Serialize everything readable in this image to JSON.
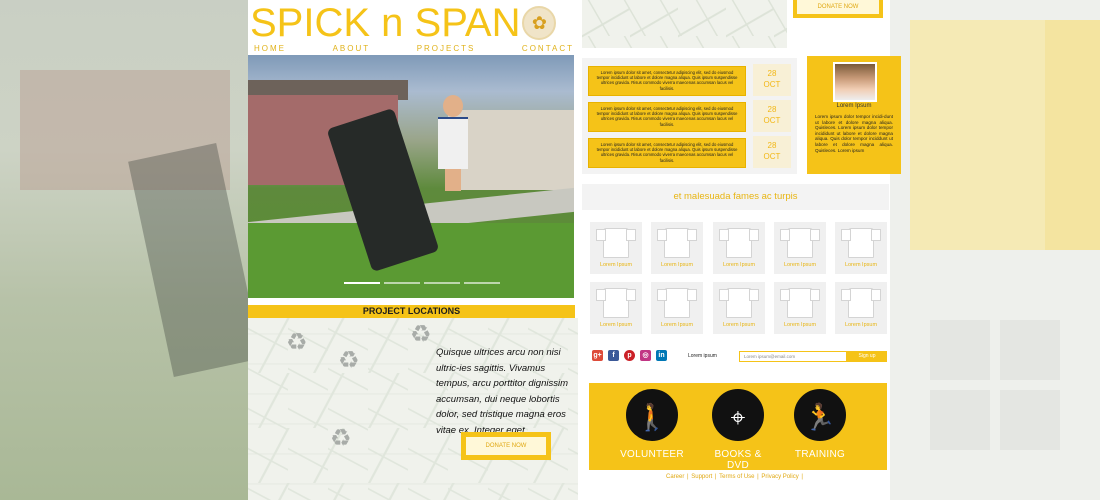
{
  "site": {
    "logo_text": "SPICK n SPAN",
    "nav": [
      "HOME",
      "ABOUT",
      "PROJECTS",
      "CONTACT"
    ]
  },
  "hero": {
    "slide_count": 4,
    "active_slide": 1
  },
  "project_locations": {
    "heading": "PROJECT LOCATIONS",
    "quote": "Quisque ultrices arcu non nisi ultric-ies sagittis. Vivamus tempus, arcu porttitor dignissim accumsan, dui neque lobortis dolor, sed tristique magna eros vitae ex. Integer eget",
    "donate_label": "DONATE NOW"
  },
  "top_donate_label": "DONATE NOW",
  "events": [
    {
      "text": "Lorem ipsum dolor sit amet, consectetur adipiscing elit, sed do eiusmod tempor incididunt ut labore et dolore magna aliqua. Quis ipsum suspendisse ultrices gravida. Risus commodo viverra maecenas accumsan lacus vel facilisis.",
      "day": "28",
      "month": "OCT"
    },
    {
      "text": "Lorem ipsum dolor sit amet, consectetur adipiscing elit, sed do eiusmod tempor incididunt ut labore et dolore magna aliqua. Quis ipsum suspendisse ultrices gravida. Risus commodo viverra maecenas accumsan lacus vel facilisis.",
      "day": "28",
      "month": "OCT"
    },
    {
      "text": "Lorem ipsum dolor sit amet, consectetur adipiscing elit, sed do eiusmod tempor incididunt ut labore et dolore magna aliqua. Quis ipsum suspendisse ultrices gravida. Risus commodo viverra maecenas accumsan lacus vel facilisis.",
      "day": "28",
      "month": "OCT"
    }
  ],
  "profile": {
    "name": "Lorem Ipsum",
    "bio": "Lorem ipsum dolor tempor incidi-dunt ut labore et dolore magna aliqua. Quisleces. Lorem ipsum dolor tempor incididunt ut labore et dolore magna aliqua. Quis dolor tempor inciddunt ut labore et dolore magna aliqua. Quisleces. Lorem ipsum"
  },
  "merch": {
    "heading": "et malesuada fames ac turpis",
    "items": [
      "Lorem Ipsum",
      "Lorem Ipsum",
      "Lorem Ipsum",
      "Lorem Ipsum",
      "Lorem Ipsum",
      "Lorem Ipsum",
      "Lorem Ipsum",
      "Lorem Ipsum",
      "Lorem Ipsum",
      "Lorem Ipsum"
    ]
  },
  "social": {
    "icons": [
      "google-plus-icon",
      "facebook-icon",
      "pinterest-icon",
      "instagram-icon",
      "linkedin-icon"
    ],
    "newsletter_label": "Lorem ipsum",
    "email_placeholder": "Lorem ipsum@email.com",
    "signup_label": "Sign up"
  },
  "cta": [
    {
      "label": "VOLUNTEER",
      "icon": "person-icon"
    },
    {
      "label": "BOOKS & DVD",
      "icon": "map-pin-icon"
    },
    {
      "label": "TRAINING",
      "icon": "runner-icon"
    }
  ],
  "footer": {
    "links": [
      "Career",
      "Support",
      "Terms of Use",
      "Privacy Policy"
    ]
  },
  "colors": {
    "accent": "#f5c318",
    "accent_text": "#e8b513"
  }
}
